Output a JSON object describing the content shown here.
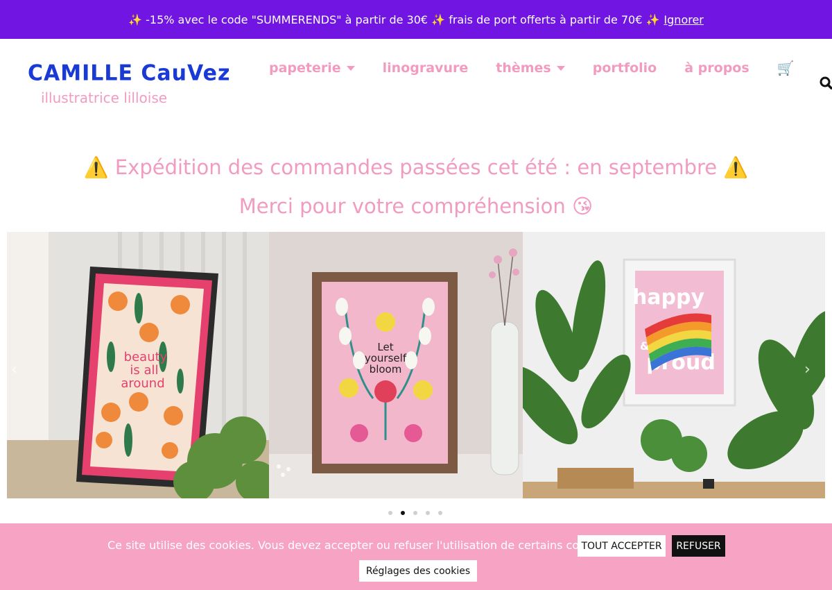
{
  "promo": {
    "text": "✨ -15% avec le code \"SUMMERENDS\" à partir de 30€ ✨ frais de port offerts à partir de 70€ ✨",
    "dismiss": "Ignorer",
    "bg": "#7115e2"
  },
  "header": {
    "logo_title": "CAMILLE CauVez",
    "logo_subtitle": "illustratrice lilloise",
    "nav": [
      {
        "label": "papeterie",
        "has_caret": true
      },
      {
        "label": "linogravure",
        "has_caret": false
      },
      {
        "label": "thèmes",
        "has_caret": true
      },
      {
        "label": "portfolio",
        "has_caret": false
      },
      {
        "label": "à propos",
        "has_caret": false
      }
    ],
    "cart_icon": "cart-icon",
    "search_icon": "search-icon",
    "accent": "#f29bc1",
    "logo_color": "#1a3ad6"
  },
  "notice": {
    "line1": "⚠️ Expédition des commandes passées cet été : en septembre ⚠️",
    "line2": "Merci pour votre compréhension 😘"
  },
  "carousel": {
    "slides": [
      {
        "poster_text": [
          "beauty",
          "is all",
          "around"
        ]
      },
      {
        "poster_text": [
          "Let",
          "yourself",
          "bloom"
        ]
      },
      {
        "poster_text": [
          "happy",
          "&",
          "proud"
        ]
      }
    ],
    "prev_icon": "chevron-left-icon",
    "next_icon": "chevron-right-icon",
    "dot_count": 5,
    "active_dot": 1
  },
  "cookie": {
    "text": "Ce site utilise des cookies. Vous devez accepter ou refuser l'utilisation de certains cookies.",
    "accept_label": "TOUT ACCEPTER",
    "refuse_label": "REFUSER",
    "settings_label": "Réglages des cookies",
    "bg": "#f6a3c4"
  }
}
